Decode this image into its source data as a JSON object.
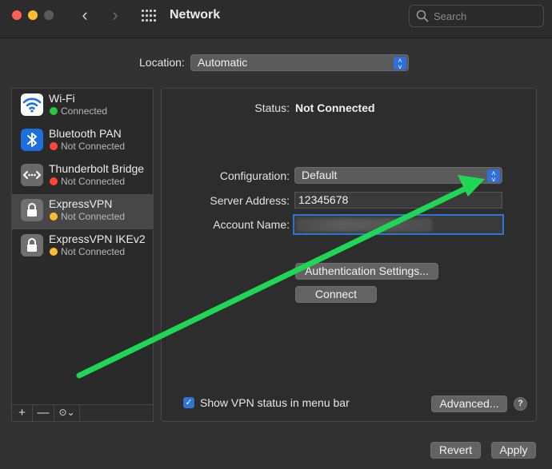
{
  "window": {
    "title": "Network"
  },
  "search": {
    "placeholder": "Search"
  },
  "location": {
    "label": "Location:",
    "value": "Automatic"
  },
  "services": [
    {
      "name": "Wi-Fi",
      "status": "Connected",
      "status_color": "#27c93f",
      "icon": "wifi-icon"
    },
    {
      "name": "Bluetooth PAN",
      "status": "Not Connected",
      "status_color": "#ff453a",
      "icon": "bluetooth-icon"
    },
    {
      "name": "Thunderbolt Bridge",
      "status": "Not Connected",
      "status_color": "#ff453a",
      "icon": "thunderbolt-bridge-icon"
    },
    {
      "name": "ExpressVPN",
      "status": "Not Connected",
      "status_color": "#febc2e",
      "icon": "lock-icon",
      "selected": true
    },
    {
      "name": "ExpressVPN IKEv2",
      "status": "Not Connected",
      "status_color": "#febc2e",
      "icon": "lock-icon"
    }
  ],
  "sidebar_tools": {
    "add": "+",
    "remove": "—",
    "action": "⊙⌄"
  },
  "detail": {
    "status_label": "Status:",
    "status_value": "Not Connected",
    "configuration_label": "Configuration:",
    "configuration_value": "Default",
    "server_label": "Server Address:",
    "server_value": "12345678",
    "account_label": "Account Name:",
    "auth_button": "Authentication Settings...",
    "connect_button": "Connect",
    "show_vpn_label": "Show VPN status in menu bar",
    "show_vpn_checked": true,
    "advanced_button": "Advanced...",
    "help": "?"
  },
  "footer": {
    "revert": "Revert",
    "apply": "Apply"
  },
  "colors": {
    "accent": "#2f74d6",
    "annotation_arrow": "#1fd655"
  }
}
